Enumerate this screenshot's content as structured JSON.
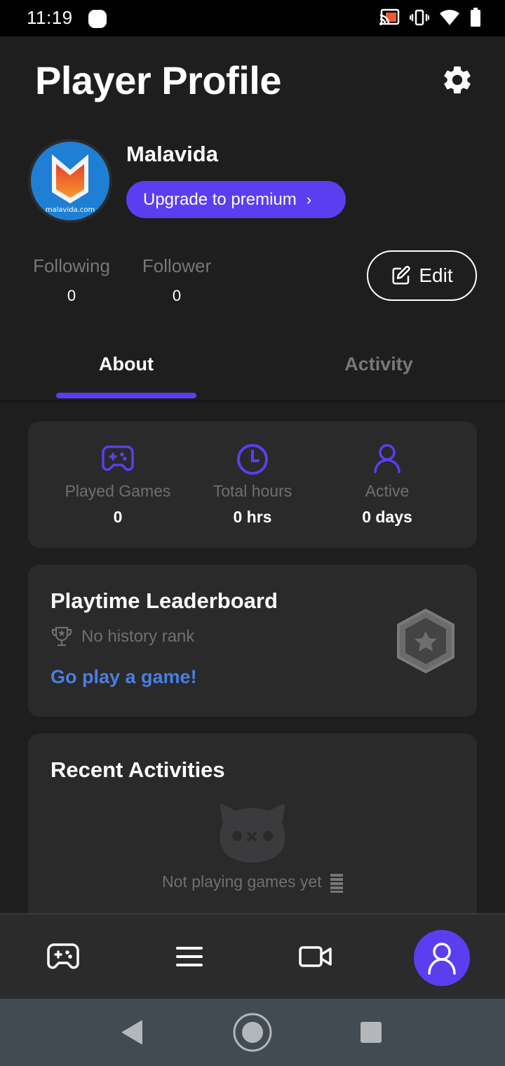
{
  "status_bar": {
    "time": "11:19",
    "icons": [
      "notification-icon",
      "cast-icon",
      "vibrate-icon",
      "wifi-icon",
      "battery-icon"
    ]
  },
  "header": {
    "title": "Player Profile",
    "settings_icon": "gear-icon"
  },
  "profile": {
    "avatar_caption": "malavida.com",
    "username": "Malavida",
    "upgrade_label": "Upgrade to premium",
    "upgrade_chevron": "›",
    "following_label": "Following",
    "following_count": "0",
    "follower_label": "Follower",
    "follower_count": "0",
    "edit_label": "Edit"
  },
  "tabs": [
    {
      "label": "About",
      "active": true
    },
    {
      "label": "Activity",
      "active": false
    }
  ],
  "stats": [
    {
      "icon": "gamepad-icon",
      "label": "Played Games",
      "value": "0"
    },
    {
      "icon": "clock-icon",
      "label": "Total hours",
      "value": "0 hrs"
    },
    {
      "icon": "user-icon",
      "label": "Active",
      "value": "0 days"
    }
  ],
  "leaderboard": {
    "title": "Playtime Leaderboard",
    "rank_text": "No history rank",
    "cta": "Go play a game!"
  },
  "recent": {
    "title": "Recent Activities",
    "empty_text": "Not playing games yet"
  },
  "bottom_nav": [
    {
      "icon": "gamepad-icon",
      "name": "games"
    },
    {
      "icon": "menu-icon",
      "name": "list"
    },
    {
      "icon": "video-camera-icon",
      "name": "video"
    },
    {
      "icon": "user-icon",
      "name": "profile",
      "active": true
    }
  ],
  "colors": {
    "accent": "#5b3ef0",
    "link": "#4a7fe0",
    "background": "#1e1e1e",
    "card": "#2a2a2b"
  }
}
